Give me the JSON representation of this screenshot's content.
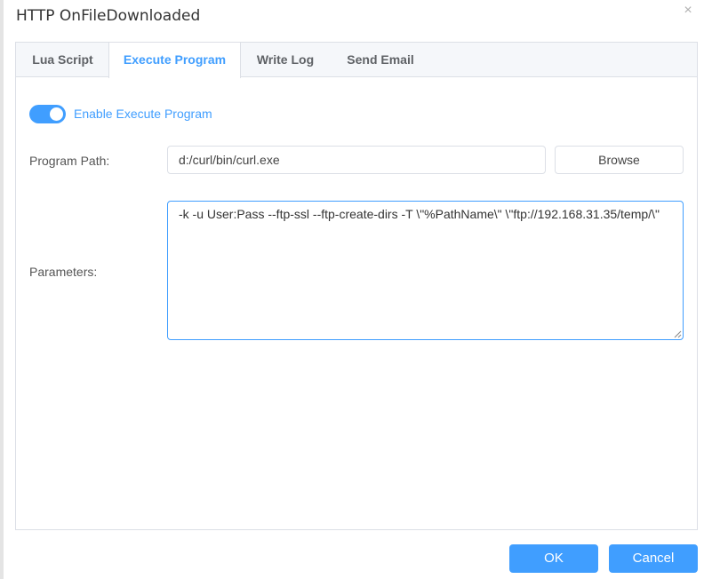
{
  "dialog": {
    "title": "HTTP OnFileDownloaded",
    "close_icon": "×"
  },
  "tabs": [
    {
      "label": "Lua Script",
      "active": false
    },
    {
      "label": "Execute Program",
      "active": true
    },
    {
      "label": "Write Log",
      "active": false
    },
    {
      "label": "Send Email",
      "active": false
    }
  ],
  "form": {
    "enable_label": "Enable Execute Program",
    "enable_on": true,
    "program_path_label": "Program Path:",
    "program_path_value": "d:/curl/bin/curl.exe",
    "browse_label": "Browse",
    "parameters_label": "Parameters:",
    "parameters_value": "-k -u User:Pass --ftp-ssl --ftp-create-dirs -T \\\"%PathName\\\" \\\"ftp://192.168.31.35/temp/\\\""
  },
  "footer": {
    "ok_label": "OK",
    "cancel_label": "Cancel"
  },
  "colors": {
    "accent": "#409eff",
    "border": "#dcdfe6",
    "tab_bg": "#f5f7fa"
  }
}
